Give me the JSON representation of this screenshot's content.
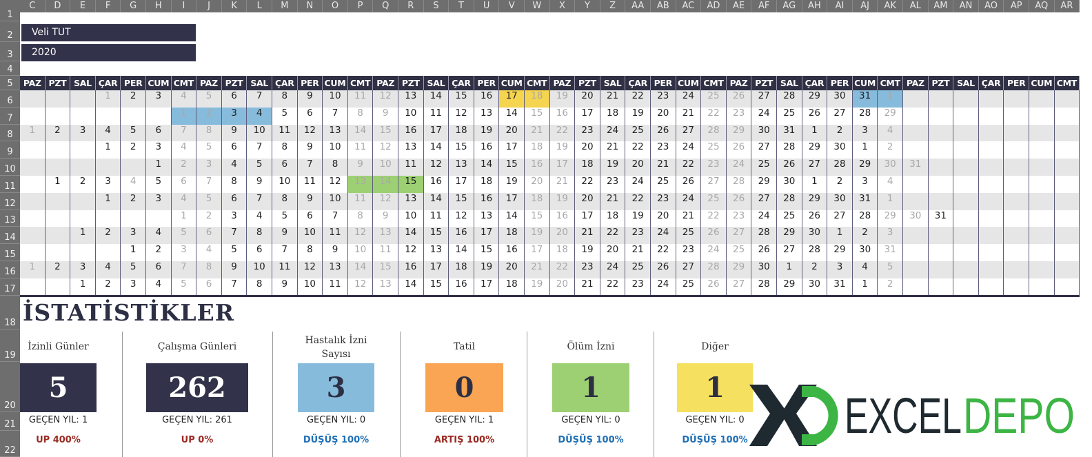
{
  "columns": [
    "C",
    "D",
    "E",
    "F",
    "G",
    "H",
    "I",
    "J",
    "K",
    "L",
    "M",
    "N",
    "O",
    "P",
    "Q",
    "R",
    "S",
    "T",
    "U",
    "V",
    "W",
    "X",
    "Y",
    "Z",
    "AA",
    "AB",
    "AC",
    "AD",
    "AE",
    "AF",
    "AG",
    "AH",
    "AI",
    "AJ",
    "AK",
    "AL",
    "AM",
    "AN",
    "AO",
    "AP",
    "AQ",
    "AR"
  ],
  "row_numbers": [
    "1",
    "2",
    "3",
    "4",
    "5",
    "6",
    "7",
    "8",
    "9",
    "10",
    "11",
    "12",
    "13",
    "14",
    "15",
    "16",
    "17",
    "18",
    "19",
    "20",
    "21",
    "22"
  ],
  "employee_name": "Veli TUT",
  "year": "2020",
  "day_headers": [
    "PAZ",
    "PZT",
    "SAL",
    "ÇAR",
    "PER",
    "CUM",
    "CMT",
    "PAZ",
    "PZT",
    "SAL",
    "ÇAR",
    "PER",
    "CUM",
    "CMT",
    "PAZ",
    "PZT",
    "SAL",
    "ÇAR",
    "PER",
    "CUM",
    "CMT",
    "PAZ",
    "PZT",
    "SAL",
    "ÇAR",
    "PER",
    "CUM",
    "CMT",
    "PAZ",
    "PZT",
    "SAL",
    "ÇAR",
    "PER",
    "CUM",
    "CMT",
    "PAZ",
    "PZT",
    "SAL",
    "ÇAR",
    "PER",
    "CUM",
    "CMT"
  ],
  "weekend_days": [
    "CMT",
    "PAZ"
  ],
  "calendar": [
    {
      "row": 6,
      "days": [
        null,
        null,
        null,
        1,
        2,
        3,
        4,
        5,
        6,
        7,
        8,
        9,
        10,
        11,
        12,
        13,
        14,
        15,
        16,
        17,
        18,
        19,
        20,
        21,
        22,
        23,
        24,
        25,
        26,
        27,
        28,
        29,
        30,
        31,
        1
      ]
    },
    {
      "row": 7,
      "days": [
        null,
        null,
        null,
        null,
        null,
        null,
        1,
        2,
        3,
        4,
        5,
        6,
        7,
        8,
        9,
        10,
        11,
        12,
        13,
        14,
        15,
        16,
        17,
        18,
        19,
        20,
        21,
        22,
        23,
        24,
        25,
        26,
        27,
        28,
        29
      ]
    },
    {
      "row": 8,
      "days": [
        1,
        2,
        3,
        4,
        5,
        6,
        7,
        8,
        9,
        10,
        11,
        12,
        13,
        14,
        15,
        16,
        17,
        18,
        19,
        20,
        21,
        22,
        23,
        24,
        25,
        26,
        27,
        28,
        29,
        30,
        31,
        1,
        2,
        3,
        4
      ]
    },
    {
      "row": 9,
      "days": [
        null,
        null,
        null,
        1,
        2,
        3,
        4,
        5,
        6,
        7,
        8,
        9,
        10,
        11,
        12,
        13,
        14,
        15,
        16,
        17,
        18,
        19,
        20,
        21,
        22,
        23,
        24,
        25,
        26,
        27,
        28,
        29,
        30,
        1,
        2
      ]
    },
    {
      "row": 10,
      "days": [
        null,
        null,
        null,
        null,
        null,
        1,
        2,
        3,
        4,
        5,
        6,
        7,
        8,
        9,
        10,
        11,
        12,
        13,
        14,
        15,
        16,
        17,
        18,
        19,
        20,
        21,
        22,
        23,
        24,
        25,
        26,
        27,
        28,
        29,
        30,
        31
      ]
    },
    {
      "row": 11,
      "days": [
        null,
        1,
        2,
        3,
        4,
        5,
        6,
        7,
        8,
        9,
        10,
        11,
        12,
        13,
        14,
        15,
        16,
        17,
        18,
        19,
        20,
        21,
        22,
        23,
        24,
        25,
        26,
        27,
        28,
        29,
        30,
        1,
        2,
        3,
        4
      ]
    },
    {
      "row": 12,
      "days": [
        null,
        null,
        null,
        1,
        2,
        3,
        4,
        5,
        6,
        7,
        8,
        9,
        10,
        11,
        12,
        13,
        14,
        15,
        16,
        17,
        18,
        19,
        20,
        21,
        22,
        23,
        24,
        25,
        26,
        27,
        28,
        29,
        30,
        31,
        1
      ]
    },
    {
      "row": 13,
      "days": [
        null,
        null,
        null,
        null,
        null,
        null,
        1,
        2,
        3,
        4,
        5,
        6,
        7,
        8,
        9,
        10,
        11,
        12,
        13,
        14,
        15,
        16,
        17,
        18,
        19,
        20,
        21,
        22,
        23,
        24,
        25,
        26,
        27,
        28,
        29,
        30,
        31
      ]
    },
    {
      "row": 14,
      "days": [
        null,
        null,
        1,
        2,
        3,
        4,
        5,
        6,
        7,
        8,
        9,
        10,
        11,
        12,
        13,
        14,
        15,
        16,
        17,
        18,
        19,
        20,
        21,
        22,
        23,
        24,
        25,
        26,
        27,
        28,
        29,
        30,
        1,
        2,
        3
      ]
    },
    {
      "row": 15,
      "days": [
        null,
        null,
        null,
        null,
        1,
        2,
        3,
        4,
        5,
        6,
        7,
        8,
        9,
        10,
        11,
        12,
        13,
        14,
        15,
        16,
        17,
        18,
        19,
        20,
        21,
        22,
        23,
        24,
        25,
        26,
        27,
        28,
        29,
        30,
        31
      ]
    },
    {
      "row": 16,
      "days": [
        1,
        2,
        3,
        4,
        5,
        6,
        7,
        8,
        9,
        10,
        11,
        12,
        13,
        14,
        15,
        16,
        17,
        18,
        19,
        20,
        21,
        22,
        23,
        24,
        25,
        26,
        27,
        28,
        29,
        30,
        1,
        2,
        3,
        4,
        5
      ]
    },
    {
      "row": 17,
      "days": [
        null,
        null,
        1,
        2,
        3,
        4,
        5,
        6,
        7,
        8,
        9,
        10,
        11,
        12,
        13,
        14,
        15,
        16,
        17,
        18,
        19,
        20,
        21,
        22,
        23,
        24,
        25,
        26,
        27,
        28,
        29,
        30,
        31,
        1,
        2
      ]
    }
  ],
  "holidays": [
    {
      "row": 6,
      "col": "F"
    },
    {
      "row": 11,
      "col": "G"
    }
  ],
  "highlights": [
    {
      "row": 6,
      "col": "V",
      "color": "#f5d44f"
    },
    {
      "row": 6,
      "col": "W",
      "color": "#f5d44f"
    },
    {
      "row": 6,
      "col": "AJ",
      "color": "#86bbdc"
    },
    {
      "row": 6,
      "col": "AK",
      "color": "#86bbdc"
    },
    {
      "row": 7,
      "col": "I",
      "color": "#86bbdc"
    },
    {
      "row": 7,
      "col": "J",
      "color": "#86bbdc"
    },
    {
      "row": 7,
      "col": "K",
      "color": "#86bbdc"
    },
    {
      "row": 7,
      "col": "L",
      "color": "#86bbdc"
    },
    {
      "row": 11,
      "col": "P",
      "color": "#9dd072"
    },
    {
      "row": 11,
      "col": "Q",
      "color": "#9dd072"
    },
    {
      "row": 11,
      "col": "R",
      "color": "#9dd072"
    }
  ],
  "colors": {
    "header_dark": "#2f3044",
    "row_alt": "#e6e6e6",
    "up": "#9b2a22",
    "down": "#1f6fb5"
  },
  "stats": {
    "title": "İSTATİSTİKLER",
    "items": [
      {
        "label": "İzinli Günler",
        "value": "5",
        "previous": "GEÇEN YIL: 1",
        "trend": "UP 400%",
        "trend_dir": "up",
        "box_color": "#32334a",
        "value_color": "#ffffff"
      },
      {
        "label": "Çalışma Günleri",
        "value": "262",
        "previous": "GEÇEN YIL: 261",
        "trend": "UP 0%",
        "trend_dir": "up",
        "box_color": "#32334a",
        "value_color": "#ffffff"
      },
      {
        "label": "Hastalık İzni Sayısı",
        "value": "3",
        "previous": "GEÇEN YIL: 0",
        "trend": "DÜŞÜŞ 100%",
        "trend_dir": "down",
        "box_color": "#86bbdc",
        "value_color": "#2d2f44"
      },
      {
        "label": "Tatil",
        "value": "0",
        "previous": "GEÇEN YIL: 1",
        "trend": "ARTIŞ 100%",
        "trend_dir": "up",
        "box_color": "#f9a553",
        "value_color": "#2d2f44"
      },
      {
        "label": "Ölüm İzni",
        "value": "1",
        "previous": "GEÇEN YIL: 0",
        "trend": "DÜŞÜŞ 100%",
        "trend_dir": "down",
        "box_color": "#9dd072",
        "value_color": "#2d2f44"
      },
      {
        "label": "Diğer",
        "value": "1",
        "previous": "GEÇEN YIL: 0",
        "trend": "DÜŞÜŞ 100%",
        "trend_dir": "down",
        "box_color": "#f5e05f",
        "value_color": "#2d2f44"
      }
    ]
  },
  "logo": {
    "part1": "EXCEL",
    "part2": "DEPO",
    "dark": "#1f2a30",
    "green": "#3db544"
  }
}
